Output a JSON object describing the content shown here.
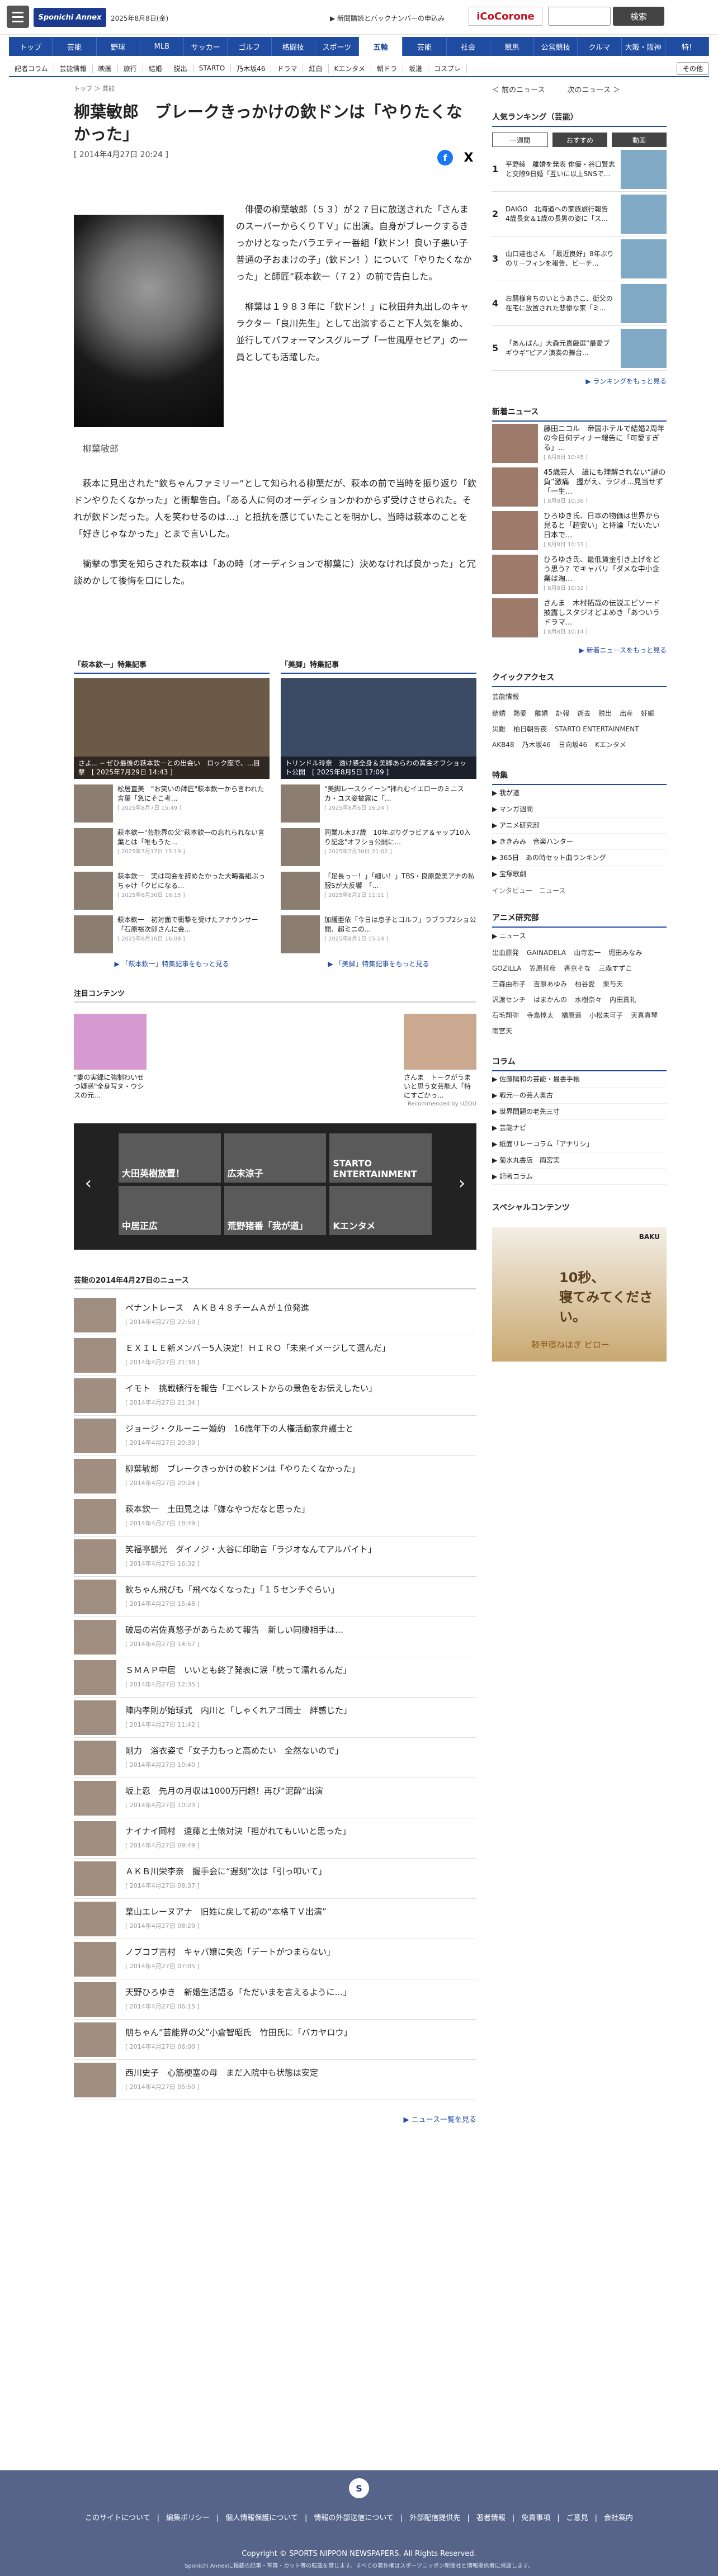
{
  "header": {
    "logo": "Sponichi Annex",
    "date": "2025年8月8日(金)",
    "notice": "▶ 新聞購読とバックナンバーの申込み",
    "corone": "iCoCorone",
    "search_btn": "検索"
  },
  "gnav": [
    "トップ",
    "芸能",
    "野球",
    "MLB",
    "サッカー",
    "ゴルフ",
    "格闘技",
    "スポーツ",
    "五輪",
    "芸能",
    "社会",
    "競馬",
    "公営競技",
    "クルマ",
    "大阪・阪神",
    "特!"
  ],
  "snav": [
    "記者コラム",
    "芸能情報",
    "映画",
    "旅行",
    "結婚",
    "脱出",
    "STARTO",
    "乃木坂46",
    "ドラマ",
    "紅白",
    "Kエンタメ",
    "朝ドラ",
    "坂道",
    "コスプレ"
  ],
  "snav_more": "その他",
  "breadcrumb": "トップ ＞ 芸能",
  "article": {
    "title": "柳葉敏郎　ブレークきっかけの欽ドンは「やりたくなかった」",
    "date": "[ 2014年4月27日 20:24 ]",
    "photo_caption": "柳葉敏郎",
    "share_fb": "f",
    "share_x": "X",
    "paragraphs": [
      "俳優の柳葉敏郎（５３）が２７日に放送された「さんまのスーパーからくりＴＶ」に出演。自身がブレークするきっかけとなったバラエティー番組「欽ドン！良い子悪い子普通の子おまけの子」(欽ドン！）について「やりたくなかった」と師匠”萩本欽一（７２）の前で告白した。",
      "柳葉は１９８３年に「欽ドン！」に秋田弁丸出しのキャラクター「良川先生」として出演すること下人気を集め、並行してパフォーマンスグループ「一世風靡セピア」の一員としても活躍した。",
      "萩本に見出された”欽ちゃんファミリー”として知られる柳葉だが、萩本の前で当時を振り返り「欽ドンやりたくなかった」と衝撃告白。「ある人に何のオーディションかわからず受けさせられた。それが欽ドンだった。人を笑わせるのは…」と抵抗を感じていたことを明かし、当時は萩本のことを「好きじゃなかった」とまで言いした。",
      "衝撃の事実を知らされた萩本は「あの時（オーディションで柳葉に）決めなければ良かった」と冗談めかして後悔を口にした。"
    ]
  },
  "related": [
    {
      "header": "「萩本欽一」特集記事",
      "hero": "さよ... ─ ぜひ最後の萩本欽一との出会い　ロック座で、...目撃　[ 2025年7月29日 14:43 ]",
      "items": [
        {
          "title": "松居直美　\"お笑いの師匠\"萩本欽一から言われた言葉「急にそこ考...",
          "date": "[ 2025年8月7日 15:49 ]"
        },
        {
          "title": "萩本欽一\"芸能界の父\"萩本欽一の忘れられない言葉とは「唯もうた...",
          "date": "[ 2025年7月17日 15:19 ]"
        },
        {
          "title": "萩本欽一　実は司会を辞めたかった大晦番組ぶっちゃけ「クビになる...",
          "date": "[ 2025年6月30日 16:15 ]"
        },
        {
          "title": "萩本欽一　初対面で衝撃を受けたアナウンサー「石原裕次郎さんに会...",
          "date": "[ 2025年6月10日 16:08 ]"
        }
      ],
      "more": "▶ 「萩本欽一」特集記事をもっと見る"
    },
    {
      "header": "「美脚」特集記事",
      "hero": "トリンドル玲奈　透け感全身＆美脚あらわの黄金オフショット公開　[ 2025年8月5日 17:09 ]",
      "items": [
        {
          "title": "\"美脚レースクイーン\"拝れむイエローのミニスカ・ユス姿披露に「...",
          "date": "[ 2025年8月6日 16:24 ]"
        },
        {
          "title": "同業ル木37歳　10年ぶりグラビア＆ャップ10入り記念\"オフショ公開に...",
          "date": "[ 2025年7月30日 21:02 ]"
        },
        {
          "title": "「足長っー！」「細い！」TBS・良原愛美アナの私服Sが大反響　「...",
          "date": "[ 2025年8月2日 11:11 ]"
        },
        {
          "title": "加護亜依「今日は息子とゴルフ」ラブラブ2ショ公開、超ミニの...",
          "date": "[ 2025年8月1日 15:14 ]"
        }
      ],
      "more": "▶ 「美脚」特集記事をもっと見る"
    }
  ],
  "attention": {
    "header": "注目コンテンツ",
    "left": "\"妻の実録に強制わいせつ疑惑\"全身写ヌ・ウシスの元...",
    "right": "さんま　トークがうまいと思う女芸能人「特にすごかっ...",
    "by": "Recommended by UZOU"
  },
  "carousel": [
    "大田英樹放置！",
    "広末涼子",
    "STARTO ENTERTAINMENT",
    "中居正広",
    "荒野猪番「我が道」",
    "Kエンタメ"
  ],
  "day_list": {
    "header": "芸能の2014年4月27日のニュース",
    "items": [
      {
        "title": "ペナントレース　ＡＫＢ４８チームＡが１位発進",
        "date": "[ 2014年4月27日 22:59 ]"
      },
      {
        "title": "ＥＸＩＬＥ新メンバー5人決定！ＨＩＲＯ「未来イメージして選んだ」",
        "date": "[ 2014年4月27日 21:38 ]"
      },
      {
        "title": "イモト　挑戦頓行を報告「エベレストからの景色をお伝えしたい」",
        "date": "[ 2014年4月27日 21:34 ]"
      },
      {
        "title": "ジョージ・クルーニー婚約　16歳年下の人権活動家弁護士と",
        "date": "[ 2014年4月27日 20:39 ]"
      },
      {
        "title": "柳葉敏郎　ブレークきっかけの欽ドンは「やりたくなかった」",
        "date": "[ 2014年4月27日 20:24 ]"
      },
      {
        "title": "萩本欽一　土田晃之は「嫌なやつだなと思った」",
        "date": "[ 2014年4月27日 18:49 ]"
      },
      {
        "title": "笑福亭鶴光　ダイノジ・大谷に印助言「ラジオなんてアルバイト」",
        "date": "[ 2014年4月27日 16:32 ]"
      },
      {
        "title": "欽ちゃん飛びも「飛べなくなった」「１５センチぐらい」",
        "date": "[ 2014年4月27日 15:48 ]"
      },
      {
        "title": "破局の岩佐真悠子があらためて報告　新しい同棲相手は…",
        "date": "[ 2014年4月27日 14:57 ]"
      },
      {
        "title": "ＳＭＡＰ中居　いいとも終了発表に涙「枕って濡れるんだ」",
        "date": "[ 2014年4月27日 12:35 ]"
      },
      {
        "title": "陣内孝則が始球式　内川と「しゃくれアゴ同士　絆感じた」",
        "date": "[ 2014年4月27日 11:42 ]"
      },
      {
        "title": "剛力　浴衣姿で「女子力もっと高めたい　全然ないので」",
        "date": "[ 2014年4月27日 10:40 ]"
      },
      {
        "title": "坂上忍　先月の月収は1000万円超！再び“泥酔”出演",
        "date": "[ 2014年4月27日 10:23 ]"
      },
      {
        "title": "ナイナイ岡村　遠藤と土俵対決「担がれてもいいと思った」",
        "date": "[ 2014年4月27日 09:49 ]"
      },
      {
        "title": "ＡＫＢ川栄李奈　握手会に“遅刻”次は「引っ叩いて」",
        "date": "[ 2014年4月27日 08:37 ]"
      },
      {
        "title": "葉山エレーヌアナ　旧姓に戻して初の“本格ＴＶ出演”",
        "date": "[ 2014年4月27日 08:29 ]"
      },
      {
        "title": "ノブコブ吉村　キャバ嬢に失恋「デートがつまらない」",
        "date": "[ 2014年4月27日 07:05 ]"
      },
      {
        "title": "天野ひろゆき　新婚生活語る「ただいまを言えるように…」",
        "date": "[ 2014年4月27日 06:15 ]"
      },
      {
        "title": "朋ちゃん“芸能界の父”小倉智昭氏　竹田氏に「バカヤロウ」",
        "date": "[ 2014年4月27日 06:00 ]"
      },
      {
        "title": "西川史子　心筋梗塞の母　まだ入院中も状態は安定",
        "date": "[ 2014年4月27日 05:50 ]"
      }
    ],
    "more": "▶ ニュース一覧を見る"
  },
  "side": {
    "prev": "＜ 前のニュース",
    "next": "次のニュース ＞",
    "ranking": {
      "header": "人気ランキング（芸能）",
      "tabs": [
        "一週間",
        "おすすめ",
        "動画"
      ],
      "items": [
        {
          "n": "1",
          "title": "平野綾　離婚を発表 俳優・谷口賢志と交際9日婚「互いに以上SNSで..."
        },
        {
          "n": "2",
          "title": "DAIGO　北海道への家族旅行報告　4歳長女＆1歳の長男の姿に「ス..."
        },
        {
          "n": "3",
          "title": "山口達也さん　「最近良好」8年ぶりのサーフィンを報告、ビーチ..."
        },
        {
          "n": "4",
          "title": "お騒様育ちのいとうあさこ、街父の在宅に放置された悲惨な家「ミ..."
        },
        {
          "n": "5",
          "title": "「あんぱん」大森元貴厳選“最愛ブギウギ”ピアノ演奏の舞台..."
        }
      ],
      "more": "▶ ランキングをもっと見る"
    },
    "news": {
      "header": "新着ニュース",
      "items": [
        {
          "title": "藤田ニコル　帝国ホテルで結婚2周年の今日何ディナー報告に「可愛すぎる」...",
          "date": "[ 8月8日 10:45 ]"
        },
        {
          "title": "45歳芸人　誰にも理解されない“謎の負”激痛　握がえ、ラジオ...見当せず「一生...",
          "date": "[ 8月8日 10:36 ]"
        },
        {
          "title": "ひろゆき氏、日本の物価は世界から見ると「超安い」と持論「だいたい日本で...",
          "date": "[ 8月8日 10:33 ]"
        },
        {
          "title": "ひろゆき氏、最低賃金引き上げをどう思う？でキャバリ「ダメな中小企業は淘...",
          "date": "[ 8月8日 10:32 ]"
        },
        {
          "title": "さんま　木村拓哉の伝説エピソード披露しスタジオどよめき「あついうドラマ...",
          "date": "[ 8月8日 10:14 ]"
        }
      ],
      "more": "▶ 新着ニュースをもっと見る"
    },
    "quick": {
      "header": "クイックアクセス",
      "btn": "芸能情報",
      "links": [
        "結婚",
        "熱愛",
        "離婚",
        "訃報",
        "逝去",
        "脱出",
        "出産",
        "妊娠",
        "災難",
        "柏日朝告夜",
        "STARTO ENTERTAINMENT",
        "AKB48",
        "乃木坂46",
        "日向坂46",
        "Kエンタメ"
      ]
    },
    "tokushu": {
      "header": "特集",
      "items": [
        "▶ 我が道",
        "▶ マンガ週間",
        "▶ アニメ研究部",
        "▶ ききみみ　音楽ハンター",
        "▶ 365日　あの時セット曲ランキング",
        "▶ 宝塚歌劇"
      ],
      "tags": "インタビュー　ニュース"
    },
    "anime": {
      "header": "アニメ研究部",
      "item": "▶ ニュース",
      "links": [
        "出血原発",
        "GAINADELA",
        "山寺宏一",
        "堀田みなみ",
        "GOZILLA",
        "笠原哲彦",
        "香京そな",
        "三森すずこ",
        "三森由布子",
        "吉原あゆみ",
        "柏谷愛",
        "栗与天",
        "沢渡センチ",
        "はまかんの",
        "水樹奈々",
        "内田真礼",
        "石毛翔弥",
        "寺島惇太",
        "福原遥",
        "小松未可子",
        "天真真琴",
        "雨宮天"
      ]
    },
    "column": {
      "header": "コラム",
      "items": [
        "▶ 佐藤陽和の芸能・最書手帳",
        "▶ 戦元一の芸人奥古",
        "▶ 世界問題の老先三寸",
        "▶ 芸能ナビ",
        "▶ 紙面リレーコラム「アナリシ」",
        "▶ 菊水丸書店　雨宮実",
        "▶ 記者コラム"
      ]
    },
    "special": {
      "header": "スペシャルコンテンツ",
      "ad_title": "10秒、\n寝てみてください。",
      "ad_bottom": "軽甲寝ねはぎ ピロー",
      "ad_brand": "BAKU"
    }
  },
  "footer": {
    "logo": "S",
    "links": [
      "このサイトについて",
      "編集ポリシー",
      "個人情報保護について",
      "情報の外部送信について",
      "外部配信提供先",
      "著者情報",
      "免責事項",
      "ご意見",
      "会社案内"
    ],
    "copyright": "Copyright © SPORTS NIPPON NEWSPAPERS. All Rights Reserved.",
    "note": "Sponichi Annexに掲載の記事・写真・カット等の転載を禁じます。すべての著作権はスポーツニッポン新聞社と情報提供者に帰属します。"
  }
}
